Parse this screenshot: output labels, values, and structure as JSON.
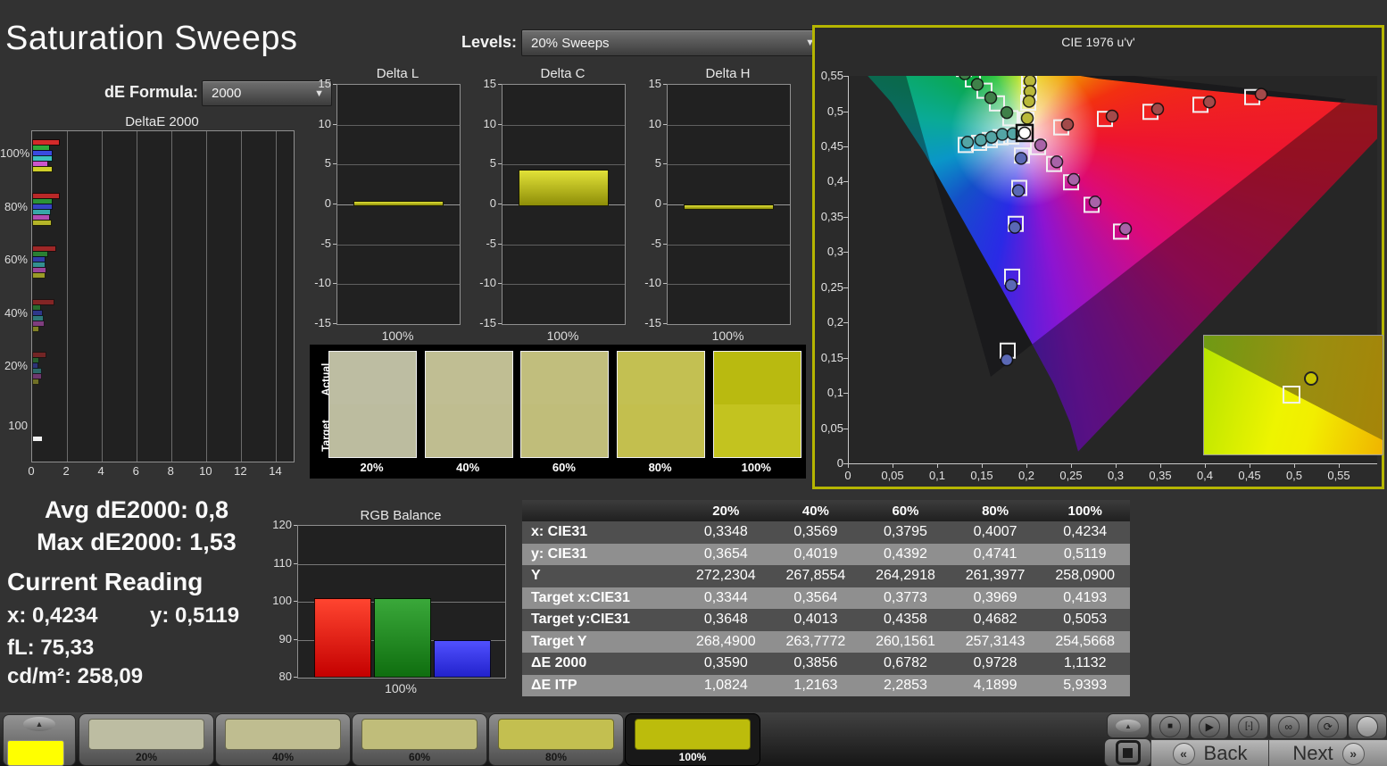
{
  "window": {
    "title": "Saturation Sweeps"
  },
  "controls": {
    "de_formula": {
      "label": "dE Formula:",
      "value": "2000"
    },
    "levels": {
      "label": "Levels:",
      "value": "20% Sweeps"
    }
  },
  "deltae2000_chart": {
    "type": "bar",
    "title": "DeltaE 2000",
    "x_ticks": [
      "0",
      "2",
      "4",
      "6",
      "8",
      "10",
      "12",
      "14"
    ],
    "x_max": 15,
    "series_colors": [
      "#d42a2a",
      "#2fa83c",
      "#3a4ae0",
      "#3cc0c0",
      "#cc55cc",
      "#cfcf2a"
    ],
    "groups": [
      {
        "label": "100%",
        "values": [
          1.5,
          0.9,
          1.1,
          1.1,
          0.8,
          1.1
        ],
        "opacity": 1
      },
      {
        "label": "80%",
        "values": [
          1.5,
          1.05,
          1.1,
          0.95,
          0.9,
          1.0
        ],
        "opacity": 0.85
      },
      {
        "label": "60%",
        "values": [
          1.3,
          0.8,
          0.65,
          0.65,
          0.7,
          0.65
        ],
        "opacity": 0.7
      },
      {
        "label": "40%",
        "values": [
          1.2,
          0.4,
          0.5,
          0.55,
          0.6,
          0.3
        ],
        "opacity": 0.55
      },
      {
        "label": "20%",
        "values": [
          0.7,
          0.3,
          0.25,
          0.45,
          0.45,
          0.3
        ],
        "opacity": 0.45
      },
      {
        "label": "100",
        "values": [
          0.5
        ],
        "white": true,
        "opacity": 1
      }
    ]
  },
  "delta_lch_charts": {
    "type": "bar",
    "y_ticks": [
      "15",
      "10",
      "5",
      "0",
      "-5",
      "-10",
      "-15"
    ],
    "y_range": 15,
    "x_label": "100%",
    "charts": [
      {
        "title": "Delta L",
        "value": 0.5
      },
      {
        "title": "Delta C",
        "value": 4.4
      },
      {
        "title": "Delta H",
        "value": -0.45
      }
    ]
  },
  "swatch_compare": {
    "row_labels": [
      "Actual",
      "Target"
    ],
    "items": [
      {
        "label": "20%",
        "actual": "#bdbda2",
        "target": "#bcbc9f"
      },
      {
        "label": "40%",
        "actual": "#c0be93",
        "target": "#bfbd90"
      },
      {
        "label": "60%",
        "actual": "#c1be7d",
        "target": "#c0bd7a"
      },
      {
        "label": "80%",
        "actual": "#c3c052",
        "target": "#c3bf4e"
      },
      {
        "label": "100%",
        "actual": "#b9ba10",
        "target": "#c3c31f"
      }
    ]
  },
  "cie_chart": {
    "type": "scatter",
    "title": "CIE 1976 u'v'",
    "border_color": "#b5b500",
    "x_ticks": [
      "0",
      "0,05",
      "0,1",
      "0,15",
      "0,2",
      "0,25",
      "0,3",
      "0,35",
      "0,4",
      "0,45",
      "0,5",
      "0,55"
    ],
    "y_ticks": [
      "0",
      "0,05",
      "0,1",
      "0,15",
      "0,2",
      "0,25",
      "0,3",
      "0,35",
      "0,4",
      "0,45",
      "0,5",
      "0,55"
    ],
    "white_point": {
      "u": 0.197,
      "v": 0.469
    },
    "measured": {
      "green": [
        [
          0.121,
          0.568
        ],
        [
          0.13,
          0.553
        ],
        [
          0.144,
          0.538
        ],
        [
          0.159,
          0.519
        ],
        [
          0.177,
          0.498
        ]
      ],
      "yellow": [
        [
          0.203,
          0.558
        ],
        [
          0.203,
          0.543
        ],
        [
          0.203,
          0.528
        ],
        [
          0.202,
          0.514
        ],
        [
          0.2,
          0.49
        ]
      ],
      "cyan": [
        [
          0.133,
          0.456
        ],
        [
          0.148,
          0.459
        ],
        [
          0.16,
          0.463
        ],
        [
          0.172,
          0.467
        ],
        [
          0.184,
          0.468
        ]
      ],
      "red": [
        [
          0.245,
          0.481
        ],
        [
          0.295,
          0.493
        ],
        [
          0.346,
          0.503
        ],
        [
          0.404,
          0.513
        ],
        [
          0.462,
          0.524
        ]
      ],
      "magenta": [
        [
          0.215,
          0.452
        ],
        [
          0.233,
          0.428
        ],
        [
          0.252,
          0.403
        ],
        [
          0.276,
          0.371
        ],
        [
          0.31,
          0.333
        ]
      ],
      "blue": [
        [
          0.193,
          0.433
        ],
        [
          0.19,
          0.387
        ],
        [
          0.186,
          0.335
        ],
        [
          0.182,
          0.253
        ],
        [
          0.177,
          0.147
        ]
      ]
    },
    "targets": {
      "green": [
        [
          0.129,
          0.56
        ],
        [
          0.139,
          0.545
        ],
        [
          0.152,
          0.529
        ],
        [
          0.166,
          0.511
        ],
        [
          0.181,
          0.49
        ]
      ],
      "yellow": [
        [
          0.202,
          0.556
        ],
        [
          0.202,
          0.541
        ],
        [
          0.202,
          0.526
        ],
        [
          0.201,
          0.512
        ],
        [
          0.199,
          0.488
        ]
      ],
      "cyan": [
        [
          0.131,
          0.452
        ],
        [
          0.146,
          0.455
        ],
        [
          0.158,
          0.459
        ],
        [
          0.17,
          0.463
        ],
        [
          0.182,
          0.464
        ]
      ],
      "red": [
        [
          0.238,
          0.477
        ],
        [
          0.287,
          0.489
        ],
        [
          0.338,
          0.499
        ],
        [
          0.394,
          0.509
        ],
        [
          0.452,
          0.52
        ]
      ],
      "magenta": [
        [
          0.212,
          0.449
        ],
        [
          0.23,
          0.425
        ],
        [
          0.249,
          0.399
        ],
        [
          0.272,
          0.367
        ],
        [
          0.305,
          0.329
        ]
      ],
      "blue": [
        [
          0.194,
          0.437
        ],
        [
          0.191,
          0.391
        ],
        [
          0.187,
          0.34
        ],
        [
          0.183,
          0.265
        ],
        [
          0.178,
          0.16
        ]
      ]
    },
    "series_fill": {
      "green": "#3f8049",
      "yellow": "#b9b93a",
      "cyan": "#53a5a5",
      "red": "#a34a4a",
      "magenta": "#a863a8",
      "blue": "#5a68b5"
    }
  },
  "stats": {
    "avg": "Avg dE2000: 0,8",
    "max": "Max dE2000: 1,53",
    "current_reading": "Current Reading",
    "x": "x: 0,4234",
    "y": "y: 0,5119",
    "fl": "fL: 75,33",
    "cd": "cd/m²: 258,09"
  },
  "rgb_balance": {
    "type": "bar",
    "title": "RGB Balance",
    "y_ticks": [
      "120",
      "110",
      "100",
      "90",
      "80"
    ],
    "y_min": 80,
    "y_max": 120,
    "x_label": "100%",
    "bars": [
      {
        "name": "red",
        "value": 100.5,
        "color_top": "#ff4530",
        "color_bottom": "#c40000"
      },
      {
        "name": "green",
        "value": 100.5,
        "color_top": "#3aa83a",
        "color_bottom": "#0f6e0f"
      },
      {
        "name": "blue",
        "value": 89.5,
        "color_top": "#5050ff",
        "color_bottom": "#2222cc"
      }
    ]
  },
  "table": {
    "headers": [
      "20%",
      "40%",
      "60%",
      "80%",
      "100%"
    ],
    "rows": [
      {
        "label": "x: CIE31",
        "values": [
          "0,3348",
          "0,3569",
          "0,3795",
          "0,4007",
          "0,4234"
        ]
      },
      {
        "label": "y: CIE31",
        "values": [
          "0,3654",
          "0,4019",
          "0,4392",
          "0,4741",
          "0,5119"
        ]
      },
      {
        "label": "Y",
        "values": [
          "272,2304",
          "267,8554",
          "264,2918",
          "261,3977",
          "258,0900"
        ]
      },
      {
        "label": "Target x:CIE31",
        "values": [
          "0,3344",
          "0,3564",
          "0,3773",
          "0,3969",
          "0,4193"
        ]
      },
      {
        "label": "Target y:CIE31",
        "values": [
          "0,3648",
          "0,4013",
          "0,4358",
          "0,4682",
          "0,5053"
        ]
      },
      {
        "label": "Target Y",
        "values": [
          "268,4900",
          "263,7772",
          "260,1561",
          "257,3143",
          "254,5668"
        ]
      },
      {
        "label": "ΔE 2000",
        "values": [
          "0,3590",
          "0,3856",
          "0,6782",
          "0,9728",
          "1,1132"
        ]
      },
      {
        "label": "ΔE ITP",
        "values": [
          "1,0824",
          "1,2163",
          "2,2853",
          "4,1899",
          "5,9393"
        ]
      }
    ]
  },
  "bottom_bar": {
    "current_color": "#ffff00",
    "buttons": [
      {
        "label": "20%",
        "color": "#bdbda2",
        "selected": false
      },
      {
        "label": "40%",
        "color": "#bfbd90",
        "selected": false
      },
      {
        "label": "60%",
        "color": "#c0bd7a",
        "selected": false
      },
      {
        "label": "80%",
        "color": "#c3bf50",
        "selected": false
      },
      {
        "label": "100%",
        "color": "#bcbc0c",
        "selected": true
      }
    ],
    "transport_icons": [
      "stop",
      "play",
      "loop",
      "infinity",
      "refresh",
      "record"
    ],
    "back": "Back",
    "next": "Next"
  }
}
